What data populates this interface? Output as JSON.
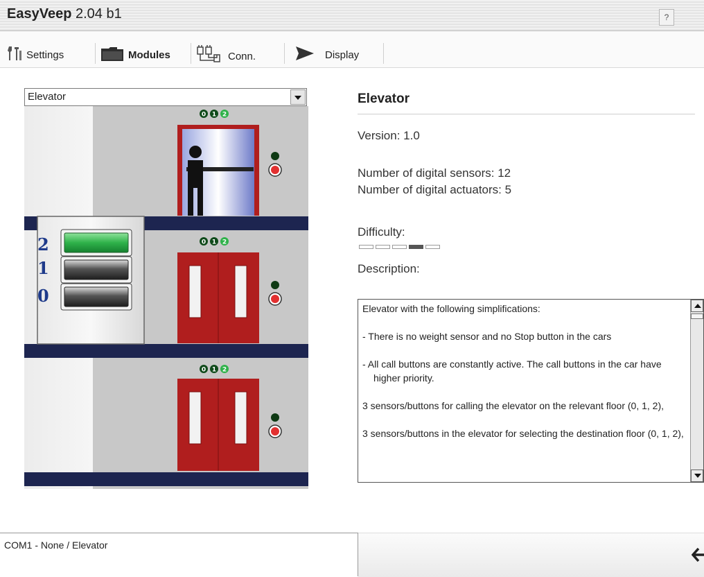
{
  "app": {
    "name": "EasyVeep",
    "version": " 2.04 b1",
    "help_label": "?"
  },
  "tabs": [
    {
      "label": "Settings",
      "icon": "settings-icon"
    },
    {
      "label": "Modules",
      "icon": "folder-icon"
    },
    {
      "label": "Conn.",
      "icon": "connection-icon"
    },
    {
      "label": "Display",
      "icon": "play-icon"
    }
  ],
  "module_select": {
    "value": "Elevator"
  },
  "simulation": {
    "floor_panel_labels": [
      "2",
      "1",
      "0"
    ],
    "floor_indicator_digits": [
      "0",
      "1",
      "2"
    ],
    "colors": {
      "door": "#b01e1e",
      "beam": "#1d2550",
      "active_button": "#2fb24a",
      "lamp_dark": "#0f3a14"
    }
  },
  "info": {
    "title": "Elevator",
    "version": "Version:  1.0",
    "sensors": "Number of digital sensors: 12",
    "actuators": "Number of digital actuators: 5",
    "difficulty_label": "Difficulty:",
    "difficulty_level": 4,
    "difficulty_max": 5,
    "description_label": "Description:"
  },
  "description": [
    "Elevator with the following simplifications:",
    "-  There is no weight sensor and no Stop button in the cars",
    "-  All call buttons are constantly active. The call buttons in the car have higher priority.",
    "3 sensors/buttons for calling the elevator on the relevant floor (0, 1, 2),",
    "3 sensors/buttons in the elevator for selecting the destination floor (0, 1, 2),"
  ],
  "status": {
    "text": "COM1 -  None / Elevator",
    "back_icon": "back-arrow-icon"
  }
}
